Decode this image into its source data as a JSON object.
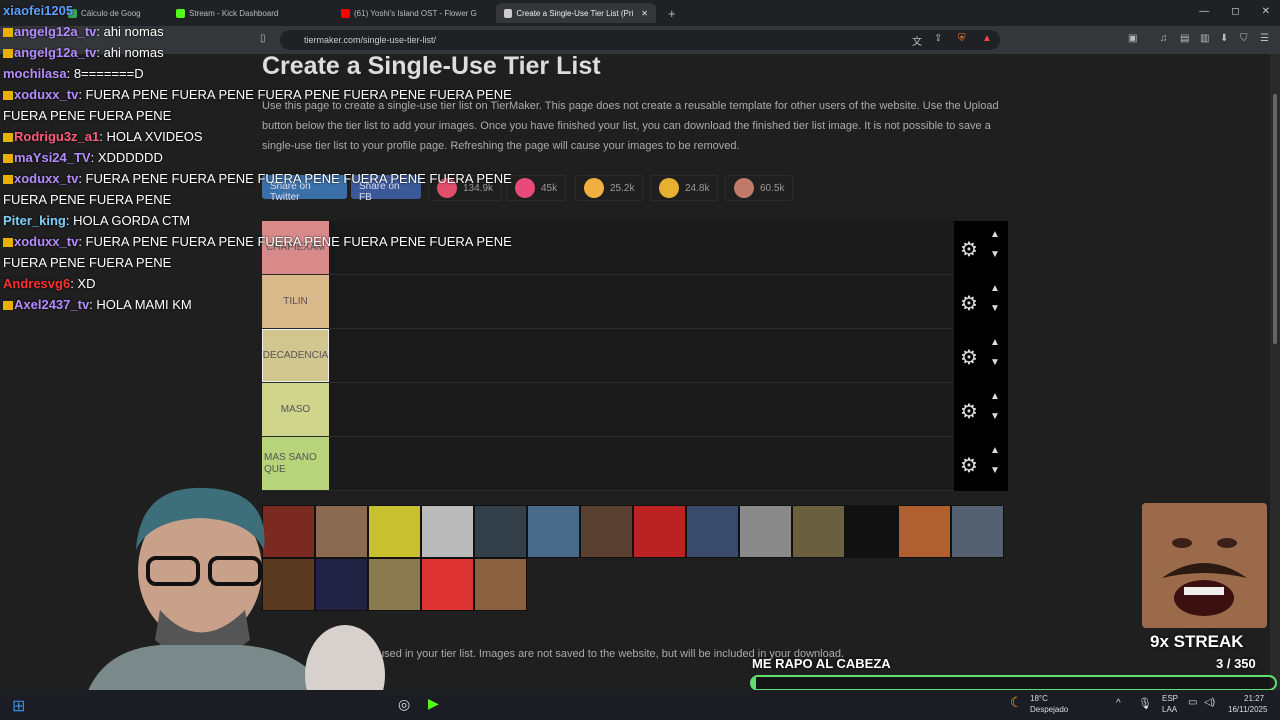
{
  "browser": {
    "tabs": [
      {
        "label": "Cálculo de Goog",
        "color": "#34a853"
      },
      {
        "label": "Stream - Kick Dashboard",
        "color": "#53fc18"
      },
      {
        "label": "(61) Yoshi's Island OST - Flower G",
        "color": "#ff0000"
      },
      {
        "label": "Create a Single-Use Tier List (Pri",
        "color": "#cccccc"
      }
    ],
    "new_tab": "+",
    "url": "tiermaker.com/single-use-tier-list/"
  },
  "page": {
    "title": "Create a Single-Use Tier List",
    "description": "Use this page to create a single-use tier list on TierMaker. This page does not create a reusable template for other users of the website. Use the Upload button below the tier list to add your images. Once you have finished your list, you can download the finished tier list image. It is not possible to save a single-use tier list to your profile page. Refreshing the page will cause your images to be removed.",
    "share_twitter": "Share on Twitter",
    "share_fb": "Share on FB",
    "reactions": [
      {
        "count": "134.9k",
        "color": "#e24d6a"
      },
      {
        "count": "45k",
        "color": "#e84a7a"
      },
      {
        "count": "25.2k",
        "color": "#f0b040"
      },
      {
        "count": "24.8k",
        "color": "#e8b030"
      },
      {
        "count": "60.5k",
        "color": "#c07a6a"
      }
    ],
    "tiers": [
      {
        "label": "CHAPIEXAM",
        "color": "#d88a8a"
      },
      {
        "label": "TILIN",
        "color": "#d9b98a"
      },
      {
        "label": "DECADENCIA",
        "color": "#d2c68f"
      },
      {
        "label": "MASO",
        "color": "#cfd58a"
      },
      {
        "label": "MAS SANO QUE",
        "color": "#b8d47a"
      }
    ],
    "posters": [
      "#7a2a20",
      "#8a6a50",
      "#c9c030",
      "#bbbbbb",
      "#33404a",
      "#4a6a8a",
      "#5a4030",
      "#b22",
      "#3a4a6a",
      "#8a8a8a",
      "#6a6040",
      "#111",
      "#b06030",
      "#556070",
      "#5a3a20",
      "#224",
      "#8a7a50",
      "#d33",
      "#8a6040"
    ],
    "footer_note": "used in your tier list. Images are not saved to the website, but will be included in your download."
  },
  "chat": [
    {
      "user": "xiaofei1205",
      "color": "#5aa0ff",
      "text": ""
    },
    {
      "user": "angelg12a_tv",
      "color": "#b38cff",
      "text": ": ahi nomas"
    },
    {
      "user": "angelg12a_tv",
      "color": "#b38cff",
      "text": ": ahi nomas"
    },
    {
      "user": "mochilasa",
      "color": "#b38cff",
      "text": ": 8=======D"
    },
    {
      "user": "xoduxx_tv",
      "color": "#b38cff",
      "text": ": FUERA PENE FUERA PENE FUERA PENE FUERA PENE FUERA PENE"
    },
    {
      "user": "",
      "color": "#fff",
      "text": "FUERA PENE FUERA PENE"
    },
    {
      "user": "Rodrigu3z_a1",
      "color": "#ff5a7a",
      "text": ": HOLA XVIDEOS"
    },
    {
      "user": "maYsi24_TV",
      "color": "#b38cff",
      "text": ": XDDDDDD"
    },
    {
      "user": "xoduxx_tv",
      "color": "#b38cff",
      "text": ": FUERA PENE FUERA PENE FUERA PENE FUERA PENE FUERA PENE"
    },
    {
      "user": "",
      "color": "#fff",
      "text": "FUERA PENE FUERA PENE"
    },
    {
      "user": "Piter_king",
      "color": "#7fd0ff",
      "text": ": HOLA GORDA CTM"
    },
    {
      "user": "xoduxx_tv",
      "color": "#b38cff",
      "text": ": FUERA PENE FUERA PENE FUERA PENE FUERA PENE FUERA PENE"
    },
    {
      "user": "",
      "color": "#fff",
      "text": "FUERA PENE FUERA PENE"
    },
    {
      "user": "Andresvg6",
      "color": "#ff3030",
      "text": ": XD"
    },
    {
      "user": "Axel2437_tv",
      "color": "#b38cff",
      "text": ": HOLA MAMI KM"
    }
  ],
  "overlay": {
    "streak": "9x STREAK",
    "goal_title": "ME RAPO AL CABEZA",
    "goal_count": "3  / 350",
    "goal_progress": 0.0086
  },
  "taskbar": {
    "weather_temp": "18°C",
    "weather_desc": "Despejado",
    "lang": "ESP",
    "lang2": "LAA",
    "time": "21:27",
    "date": "16/11/2025"
  }
}
